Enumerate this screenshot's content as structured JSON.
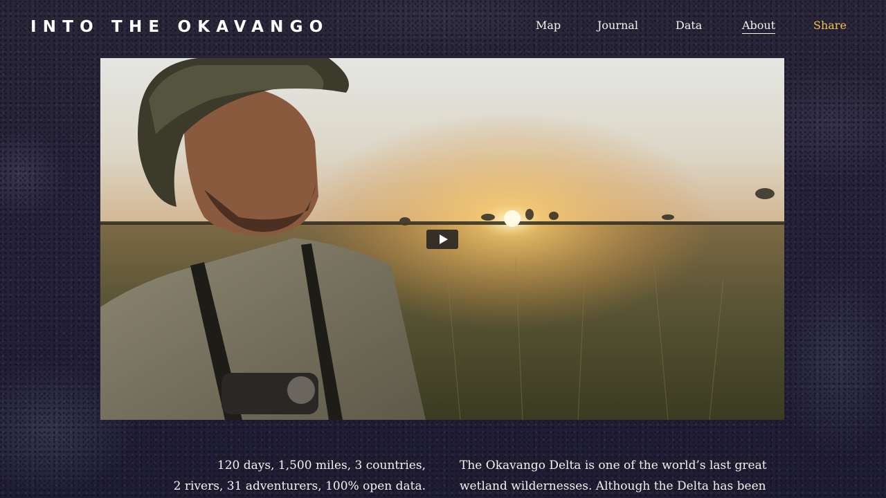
{
  "header": {
    "logo": "INTO THE OKAVANGO",
    "nav": [
      {
        "label": "Map"
      },
      {
        "label": "Journal"
      },
      {
        "label": "Data"
      },
      {
        "label": "About",
        "active": true
      },
      {
        "label": "Share",
        "accent": true
      }
    ],
    "accent_color": "#f0c24e"
  },
  "video": {
    "play_icon": "play-icon"
  },
  "intro": {
    "stats_lines": [
      "120 days, 1,500 miles, 3 countries,",
      "2 rivers, 31 adventurers, 100% open data."
    ],
    "description_lines": [
      "The Okavango Delta is one of the world’s last great",
      "wetland wildernesses. Although the Delta has been"
    ]
  }
}
